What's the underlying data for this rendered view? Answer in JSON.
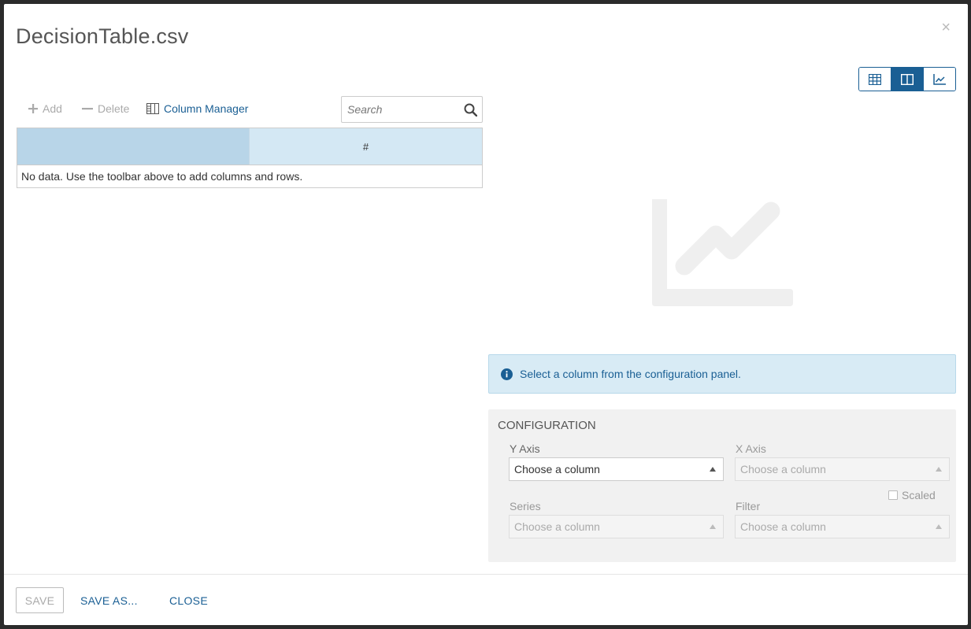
{
  "dialog": {
    "title": "DecisionTable.csv",
    "close_glyph": "×"
  },
  "view_toggle": {
    "buttons": [
      {
        "icon": "grid-view-icon",
        "active": false
      },
      {
        "icon": "split-view-icon",
        "active": true
      },
      {
        "icon": "chart-view-icon",
        "active": false
      }
    ]
  },
  "toolbar": {
    "add_label": "Add",
    "delete_label": "Delete",
    "column_manager_label": "Column Manager",
    "search_placeholder": "Search"
  },
  "grid": {
    "columns": [
      "",
      "#"
    ],
    "empty_message": "No data. Use the toolbar above to add columns and rows."
  },
  "info": {
    "message": "Select a column from the configuration panel."
  },
  "configuration": {
    "title": "CONFIGURATION",
    "y_axis": {
      "label": "Y Axis",
      "placeholder": "Choose a column"
    },
    "x_axis": {
      "label": "X Axis",
      "placeholder": "Choose a column"
    },
    "scaled_label": "Scaled",
    "series": {
      "label": "Series",
      "placeholder": "Choose a column"
    },
    "filter": {
      "label": "Filter",
      "placeholder": "Choose a column"
    }
  },
  "footer": {
    "save_label": "SAVE",
    "save_as_label": "SAVE AS...",
    "close_label": "CLOSE"
  },
  "colors": {
    "accent": "#1a5f94",
    "header_blue": "#b8d5e8",
    "info_bg": "#d8ebf5"
  }
}
